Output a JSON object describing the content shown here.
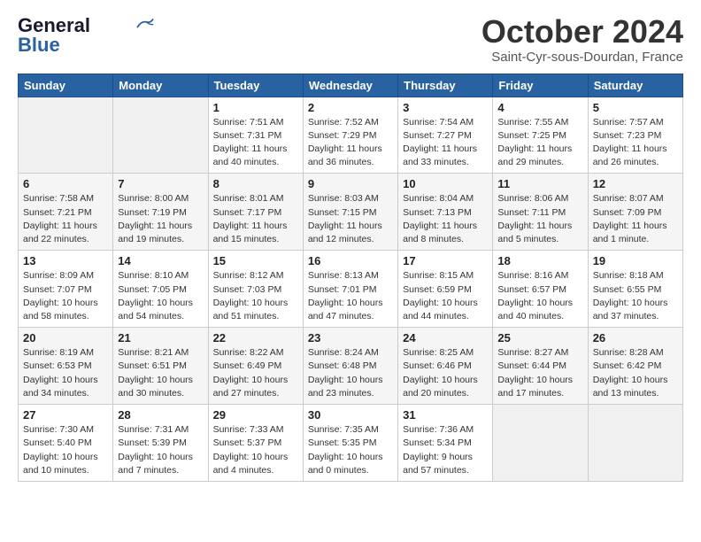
{
  "header": {
    "logo_line1": "General",
    "logo_line2": "Blue",
    "month_title": "October 2024",
    "subtitle": "Saint-Cyr-sous-Dourdan, France"
  },
  "weekdays": [
    "Sunday",
    "Monday",
    "Tuesday",
    "Wednesday",
    "Thursday",
    "Friday",
    "Saturday"
  ],
  "weeks": [
    [
      {
        "num": "",
        "info": ""
      },
      {
        "num": "",
        "info": ""
      },
      {
        "num": "1",
        "info": "Sunrise: 7:51 AM\nSunset: 7:31 PM\nDaylight: 11 hours\nand 40 minutes."
      },
      {
        "num": "2",
        "info": "Sunrise: 7:52 AM\nSunset: 7:29 PM\nDaylight: 11 hours\nand 36 minutes."
      },
      {
        "num": "3",
        "info": "Sunrise: 7:54 AM\nSunset: 7:27 PM\nDaylight: 11 hours\nand 33 minutes."
      },
      {
        "num": "4",
        "info": "Sunrise: 7:55 AM\nSunset: 7:25 PM\nDaylight: 11 hours\nand 29 minutes."
      },
      {
        "num": "5",
        "info": "Sunrise: 7:57 AM\nSunset: 7:23 PM\nDaylight: 11 hours\nand 26 minutes."
      }
    ],
    [
      {
        "num": "6",
        "info": "Sunrise: 7:58 AM\nSunset: 7:21 PM\nDaylight: 11 hours\nand 22 minutes."
      },
      {
        "num": "7",
        "info": "Sunrise: 8:00 AM\nSunset: 7:19 PM\nDaylight: 11 hours\nand 19 minutes."
      },
      {
        "num": "8",
        "info": "Sunrise: 8:01 AM\nSunset: 7:17 PM\nDaylight: 11 hours\nand 15 minutes."
      },
      {
        "num": "9",
        "info": "Sunrise: 8:03 AM\nSunset: 7:15 PM\nDaylight: 11 hours\nand 12 minutes."
      },
      {
        "num": "10",
        "info": "Sunrise: 8:04 AM\nSunset: 7:13 PM\nDaylight: 11 hours\nand 8 minutes."
      },
      {
        "num": "11",
        "info": "Sunrise: 8:06 AM\nSunset: 7:11 PM\nDaylight: 11 hours\nand 5 minutes."
      },
      {
        "num": "12",
        "info": "Sunrise: 8:07 AM\nSunset: 7:09 PM\nDaylight: 11 hours\nand 1 minute."
      }
    ],
    [
      {
        "num": "13",
        "info": "Sunrise: 8:09 AM\nSunset: 7:07 PM\nDaylight: 10 hours\nand 58 minutes."
      },
      {
        "num": "14",
        "info": "Sunrise: 8:10 AM\nSunset: 7:05 PM\nDaylight: 10 hours\nand 54 minutes."
      },
      {
        "num": "15",
        "info": "Sunrise: 8:12 AM\nSunset: 7:03 PM\nDaylight: 10 hours\nand 51 minutes."
      },
      {
        "num": "16",
        "info": "Sunrise: 8:13 AM\nSunset: 7:01 PM\nDaylight: 10 hours\nand 47 minutes."
      },
      {
        "num": "17",
        "info": "Sunrise: 8:15 AM\nSunset: 6:59 PM\nDaylight: 10 hours\nand 44 minutes."
      },
      {
        "num": "18",
        "info": "Sunrise: 8:16 AM\nSunset: 6:57 PM\nDaylight: 10 hours\nand 40 minutes."
      },
      {
        "num": "19",
        "info": "Sunrise: 8:18 AM\nSunset: 6:55 PM\nDaylight: 10 hours\nand 37 minutes."
      }
    ],
    [
      {
        "num": "20",
        "info": "Sunrise: 8:19 AM\nSunset: 6:53 PM\nDaylight: 10 hours\nand 34 minutes."
      },
      {
        "num": "21",
        "info": "Sunrise: 8:21 AM\nSunset: 6:51 PM\nDaylight: 10 hours\nand 30 minutes."
      },
      {
        "num": "22",
        "info": "Sunrise: 8:22 AM\nSunset: 6:49 PM\nDaylight: 10 hours\nand 27 minutes."
      },
      {
        "num": "23",
        "info": "Sunrise: 8:24 AM\nSunset: 6:48 PM\nDaylight: 10 hours\nand 23 minutes."
      },
      {
        "num": "24",
        "info": "Sunrise: 8:25 AM\nSunset: 6:46 PM\nDaylight: 10 hours\nand 20 minutes."
      },
      {
        "num": "25",
        "info": "Sunrise: 8:27 AM\nSunset: 6:44 PM\nDaylight: 10 hours\nand 17 minutes."
      },
      {
        "num": "26",
        "info": "Sunrise: 8:28 AM\nSunset: 6:42 PM\nDaylight: 10 hours\nand 13 minutes."
      }
    ],
    [
      {
        "num": "27",
        "info": "Sunrise: 7:30 AM\nSunset: 5:40 PM\nDaylight: 10 hours\nand 10 minutes."
      },
      {
        "num": "28",
        "info": "Sunrise: 7:31 AM\nSunset: 5:39 PM\nDaylight: 10 hours\nand 7 minutes."
      },
      {
        "num": "29",
        "info": "Sunrise: 7:33 AM\nSunset: 5:37 PM\nDaylight: 10 hours\nand 4 minutes."
      },
      {
        "num": "30",
        "info": "Sunrise: 7:35 AM\nSunset: 5:35 PM\nDaylight: 10 hours\nand 0 minutes."
      },
      {
        "num": "31",
        "info": "Sunrise: 7:36 AM\nSunset: 5:34 PM\nDaylight: 9 hours\nand 57 minutes."
      },
      {
        "num": "",
        "info": ""
      },
      {
        "num": "",
        "info": ""
      }
    ]
  ]
}
